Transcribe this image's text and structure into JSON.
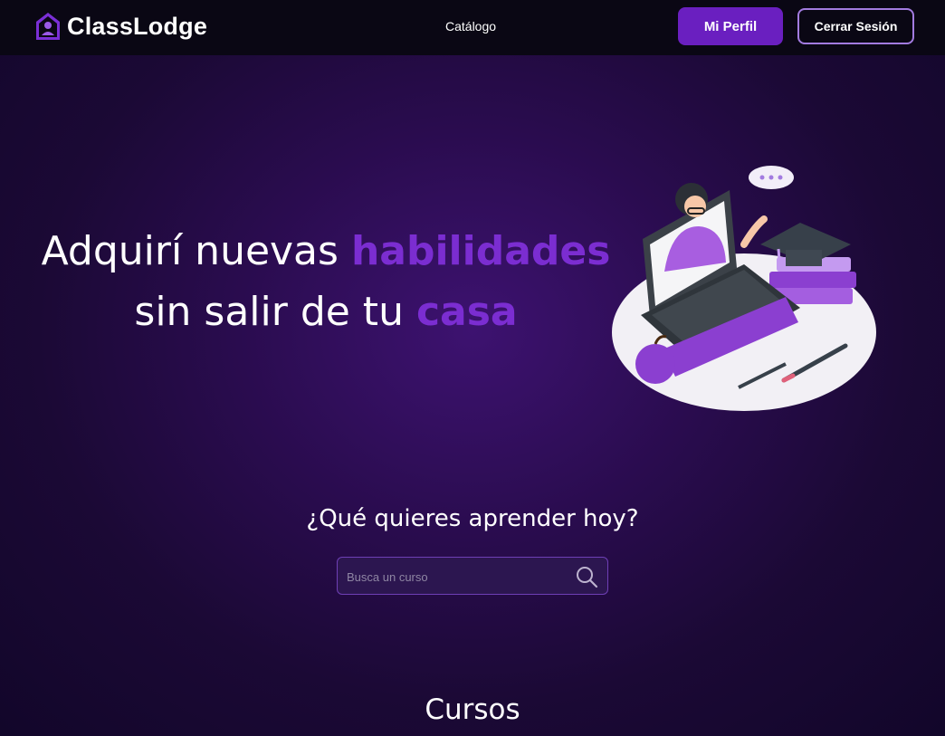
{
  "brand": {
    "name": "ClassLodge",
    "icon": "house-user-icon"
  },
  "nav": {
    "catalog_label": "Catálogo",
    "profile_label": "Mi Perfil",
    "logout_label": "Cerrar Sesión"
  },
  "hero": {
    "line1_prefix": "Adquirí nuevas ",
    "line1_highlight": "habilidades",
    "line2_prefix": "sin salir de tu ",
    "line2_highlight": "casa",
    "illustration": "online-teacher-illustration"
  },
  "search": {
    "question": "¿Qué quieres aprender hoy?",
    "placeholder": "Busca un curso",
    "icon": "search-icon"
  },
  "courses": {
    "title": "Cursos"
  },
  "colors": {
    "accent": "#7b2dd1",
    "button_bg": "#6a1fc0",
    "nav_bg": "#0a0714",
    "page_bg": "#2a0c4f"
  }
}
